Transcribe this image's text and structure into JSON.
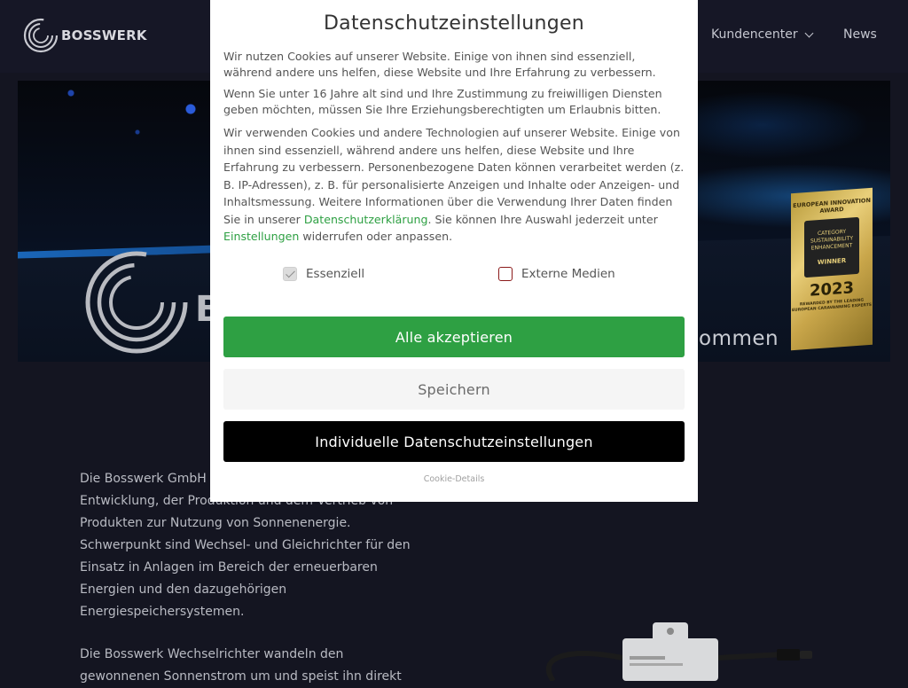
{
  "header": {
    "brand": "BOSSWERK",
    "nav": [
      {
        "label": "Kundencenter",
        "has_dropdown": true
      },
      {
        "label": "News",
        "has_dropdown": false
      }
    ]
  },
  "hero": {
    "logo_letter": "B",
    "slogan": "ommen",
    "award": {
      "line1": "EUROPEAN INNOVATION AWARD",
      "category": "CATEGORY",
      "category_sub": "SUSTAINABILITY ENHANCEMENT",
      "winner": "WINNER",
      "year": "2023",
      "footer": "REWARDED BY THE LEADING EUROPEAN CARAVANNING EXPERTS"
    }
  },
  "content": {
    "paragraph1": "Die Bosswerk GmbH & Co. KG beschäftigt sich mit der Entwicklung, der Produktion und dem Vertrieb von Produkten zur Nutzung von Sonnenenergie. Schwerpunkt sind Wechsel- und Gleichrichter für den Einsatz in Anlagen im Bereich der erneuerbaren Energien und den dazugehörigen Energiespeichersystemen.",
    "paragraph2": "Die Bosswerk Wechselrichter wandeln den gewonnenen Sonnenstrom um und speist ihn direkt"
  },
  "cookie_modal": {
    "title": "Datenschutzeinstellungen",
    "text1": "Wir nutzen Cookies auf unserer Website. Einige von ihnen sind essenziell, während andere uns helfen, diese Website und Ihre Erfahrung zu verbessern.",
    "text2": "Wenn Sie unter 16 Jahre alt sind und Ihre Zustimmung zu freiwilligen Diensten geben möchten, müssen Sie Ihre Erziehungsberechtigten um Erlaubnis bitten.",
    "text3_part1": "Wir verwenden Cookies und andere Technologien auf unserer Website. Einige von ihnen sind essenziell, während andere uns helfen, diese Website und Ihre Erfahrung zu verbessern. Personenbezogene Daten können verarbeitet werden (z. B. IP-Adressen), z. B. für personalisierte Anzeigen und Inhalte oder Anzeigen- und Inhaltsmessung. Weitere Informationen über die Verwendung Ihrer Daten finden Sie in unserer ",
    "privacy_link": "Datenschutzerklärung",
    "text3_part2": ". Sie können Ihre Auswahl jederzeit unter ",
    "settings_link": "Einstellungen",
    "text3_part3": " widerrufen oder anpassen.",
    "checkbox_essential": {
      "label": "Essenziell",
      "checked": true,
      "disabled": true
    },
    "checkbox_external": {
      "label": "Externe Medien",
      "checked": false
    },
    "accept_all": "Alle akzeptieren",
    "save": "Speichern",
    "individual": "Individuelle Datenschutzeinstellungen",
    "details_link": "Cookie-Details"
  },
  "colors": {
    "accent_green": "#2ea043",
    "page_bg": "#141521",
    "checkbox_border": "#8b1a1a"
  }
}
